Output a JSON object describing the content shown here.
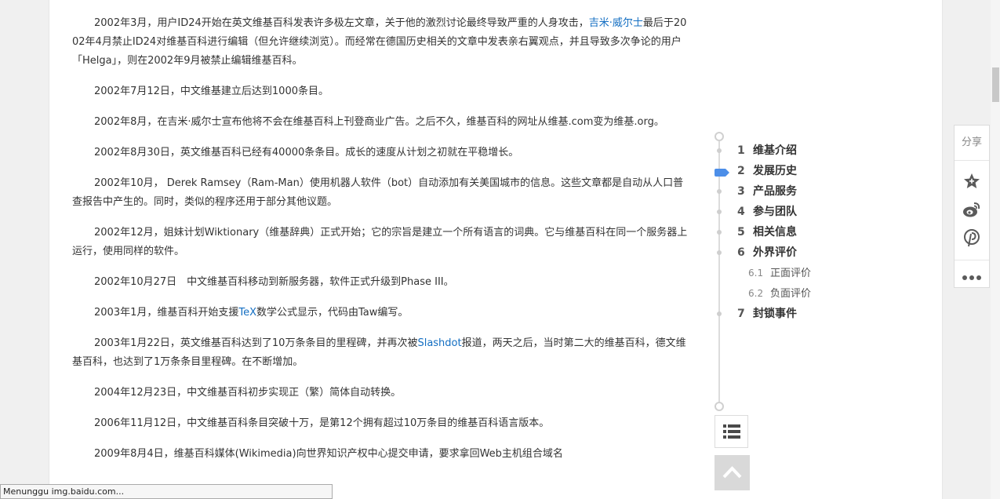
{
  "paragraphs": [
    {
      "pre": "2002年3月，用户ID24开始在英文维基百科发表许多极左文章，关于他的激烈讨论最终导致严重的人身攻击，",
      "link": "吉米·威尔士",
      "post": "最后于2002年4月禁止ID24对维基百科进行编辑（但允许继续浏览）。而经常在德国历史相关的文章中发表亲右翼观点，并且导致多次争论的用户「Helga」，则在2002年9月被禁止编辑维基百科。"
    },
    {
      "pre": "2002年7月12日，中文维基建立后达到1000条目。",
      "link": "",
      "post": ""
    },
    {
      "pre": "2002年8月，在吉米·威尔士宣布他将不会在维基百科上刊登商业广告。之后不久，维基百科的网址从维基.com变为维基.org。",
      "link": "",
      "post": ""
    },
    {
      "pre": "2002年8月30日，英文维基百科已经有40000条条目。成长的速度从计划之初就在平稳增长。",
      "link": "",
      "post": ""
    },
    {
      "pre": "2002年10月， Derek Ramsey（Ram-Man）使用机器人软件（bot）自动添加有关美国城市的信息。这些文章都是自动从人口普查报告中产生的。同时，类似的程序还用于部分其他议题。",
      "link": "",
      "post": ""
    },
    {
      "pre": "2002年12月，姐妹计划Wiktionary（维基辞典）正式开始；它的宗旨是建立一个所有语言的词典。它与维基百科在同一个服务器上运行，使用同样的软件。",
      "link": "",
      "post": ""
    },
    {
      "pre": "2002年10月27日　中文维基百科移动到新服务器，软件正式升级到Phase III。",
      "link": "",
      "post": ""
    },
    {
      "pre": "2003年1月，维基百科开始支援",
      "link": "TeX",
      "post": "数学公式显示，代码由Taw编写。"
    },
    {
      "pre": "2003年1月22日，英文维基百科达到了10万条条目的里程碑，并再次被",
      "link": "Slashdot",
      "post": "报道，两天之后，当时第二大的维基百科，德文维基百科，也达到了1万条条目里程碑。在不断增加。"
    },
    {
      "pre": "2004年12月23日，中文维基百科初步实现正（繁）简体自动转换。",
      "link": "",
      "post": ""
    },
    {
      "pre": "2006年11月12日，中文维基百科条目突破十万，是第12个拥有超过10万条目的维基百科语言版本。",
      "link": "",
      "post": ""
    },
    {
      "pre": "2009年8月4日，维基百科媒体(Wikimedia)向世界知识产权中心提交申请，要求拿回Web主机组合域名",
      "link": "",
      "post": ""
    }
  ],
  "toc": {
    "items": [
      {
        "num": "1",
        "label": "维基介绍"
      },
      {
        "num": "2",
        "label": "发展历史"
      },
      {
        "num": "3",
        "label": "产品服务"
      },
      {
        "num": "4",
        "label": "参与团队"
      },
      {
        "num": "5",
        "label": "相关信息"
      },
      {
        "num": "6",
        "label": "外界评价"
      },
      {
        "num": "7",
        "label": "封锁事件"
      }
    ],
    "subitems": [
      {
        "num": "6.1",
        "label": "正面评价"
      },
      {
        "num": "6.2",
        "label": "负面评价"
      }
    ],
    "active_index": 1
  },
  "share": {
    "label": "分享"
  },
  "status": {
    "text": "Menunggu img.baidu.com..."
  },
  "colors": {
    "link": "#136ec2",
    "toc_active": "#4c8ee8"
  }
}
